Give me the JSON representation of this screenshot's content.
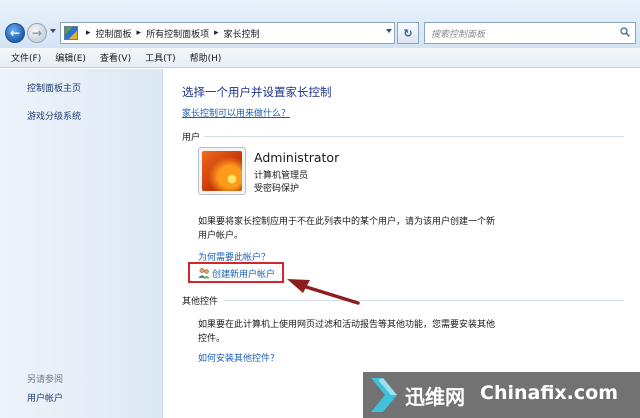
{
  "navigation": {
    "back_icon": "back-arrow-icon",
    "forward_icon": "forward-arrow-icon",
    "breadcrumbs": [
      "控制面板",
      "所有控制面板项",
      "家长控制"
    ],
    "search_placeholder": "搜索控制面板"
  },
  "menu": [
    "文件(F)",
    "编辑(E)",
    "查看(V)",
    "工具(T)",
    "帮助(H)"
  ],
  "sidebar": {
    "links": [
      "控制面板主页",
      "游戏分级系统"
    ],
    "see_also_heading": "另请参阅",
    "see_also_links": [
      "用户帐户"
    ]
  },
  "main": {
    "title": "选择一个用户并设置家长控制",
    "help_link": "家长控制可以用来做什么？",
    "users_section_label": "用户",
    "user": {
      "name": "Administrator",
      "role": "计算机管理员",
      "password_status": "受密码保护"
    },
    "create_info_line1": "如果要将家长控制应用于不在此列表中的某个用户，请为该用户创建一个新",
    "create_info_line2": "用户帐户。",
    "why_link": "为何需要此帐户？",
    "create_user_link": "创建新用户帐户",
    "other_controls_label": "其他控件",
    "other_info_line1": "如果要在此计算机上使用网页过滤和活动报告等其他功能，您需要安装其他",
    "other_info_line2": "控件。",
    "install_link": "如何安装其他控件？"
  },
  "annotation": {
    "highlight_color": "#d6262b",
    "arrow_color": "#8b1f1f"
  },
  "watermark": {
    "cn": "迅维网",
    "en": "Chinafix.com"
  }
}
